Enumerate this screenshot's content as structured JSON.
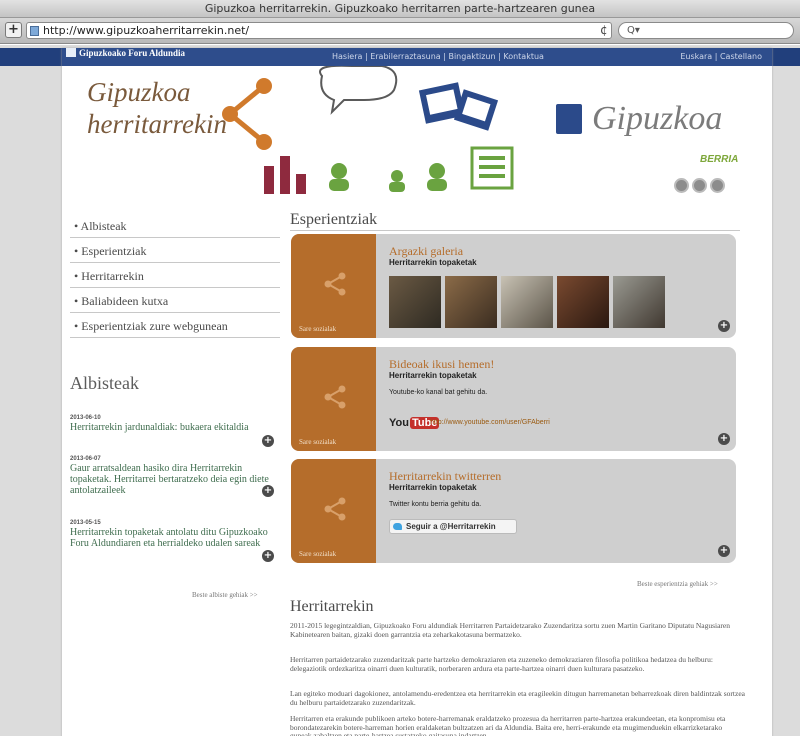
{
  "browser": {
    "window_title": "Gipuzkoa herritarrekin. Gipuzkoako herritarren parte-hartzearen gunea",
    "url": "http://www.gipuzkoaherritarrekin.net/",
    "search_placeholder": "Q▾",
    "plus": "+",
    "reload": "¢"
  },
  "topbar": {
    "brand": "Gipuzkoako Foru Aldundia",
    "nav": "Hasiera | Erabilerraztasuna | Bingaktizun | Kontaktua",
    "lang": "Euskara | Castellano"
  },
  "header": {
    "logo_line1": "Gipuzkoa",
    "logo_line2": "herritarrekin",
    "gipuzkoa": "Gipuzkoa",
    "berria": "BERRIA"
  },
  "sidebar": {
    "items": [
      "Albisteak",
      "Esperientziak",
      "Herritarrekin",
      "Baliabideen kutxa",
      "Esperientziak zure webgunean"
    ],
    "news_heading": "Albisteak",
    "news": [
      {
        "date": "2013-06-10",
        "text": "Herritarrekin jardunaldiak: bukaera ekitaldia"
      },
      {
        "date": "2013-06-07",
        "text": "Gaur arratsaldean hasiko dira Herritarrekin topaketak. Herritarrei bertaratzeko deia egin diete antolatzaileek"
      },
      {
        "date": "2013-05-15",
        "text": "Herritarrekin topaketak antolatu ditu Gipuzkoako Foru Aldundiaren eta herrialdeko udalen sareak"
      }
    ],
    "more": "Beste albiste gehiak >>"
  },
  "experiences": {
    "heading": "Esperientziak",
    "cards": [
      {
        "title": "Argazki galeria",
        "sub": "Herritarrekin topaketak",
        "share": "Sare sozialak"
      },
      {
        "title": "Bideoak ikusi hemen!",
        "sub": "Herritarrekin topaketak",
        "text": "Youtube-ko kanal bat gehitu da.",
        "yt_logo": "You",
        "yt_tube": "Tube",
        "link": "http://www.youtube.com/user/GFAberri",
        "share": "Sare sozialak"
      },
      {
        "title": "Herritarrekin twitterren",
        "sub": "Herritarrekin topaketak",
        "text": "Twitter kontu berria gehitu da.",
        "button": "Seguir a @Herritarrekin",
        "share": "Sare sozialak"
      }
    ],
    "more": "Beste esperientzia gehiak >>"
  },
  "herritarrekin": {
    "heading": "Herritarrekin",
    "paragraphs": [
      "2011-2015 legegintzaldian, Gipuzkoako Foru aldundiak Herritarren Partaidetzarako Zuzendaritza sortu zuen Martin Garitano Diputatu Nagusiaren Kabinetearen baitan, gizaki doen garrantzia eta zeharkakotasuna bermatzeko.",
      "Herritarren partaidetzarako zuzendaritzak parte hartzeko demokraziaren eta zuzeneko demokraziaren filosofia politikoa hedatzea du helburu: delegaziotik ordezkaritza oinarri duen kulturatik, norberaren ardura eta parte-hartzea oinarri duen kulturara pasatzeko.",
      "Lan egiteko moduari dagokionez, antolamendu-eredentzea eta herritarrekin eta eragileekin ditugun harremanetan beharrezkoak diren baldintzak sortzea du helburu partaidetzarako zuzendaritzak.",
      "Herritarren eta erakunde publikoen arteko botere-harremanak eraldatzeko prozesua da herritarren parte-hartzea erakundeetan, eta konpromisu eta borondatezarekin botere-harreman horien eraldaketan bultzatzen ari da Aldundia. Baita ere, herri-erakunde eta mugimenduekin elkarrizketarako guneak zabaltzen eta parte-hartzea sustatzeko gaitasuna indartzen."
    ]
  },
  "colors": {
    "brand_blue": "#2e4d8c",
    "accent_brown": "#b56d2b",
    "news_green": "#3f6d4e",
    "icon_maroon": "#8e2a3e",
    "icon_green": "#6aa340",
    "icon_blue": "#2b4a8a"
  }
}
